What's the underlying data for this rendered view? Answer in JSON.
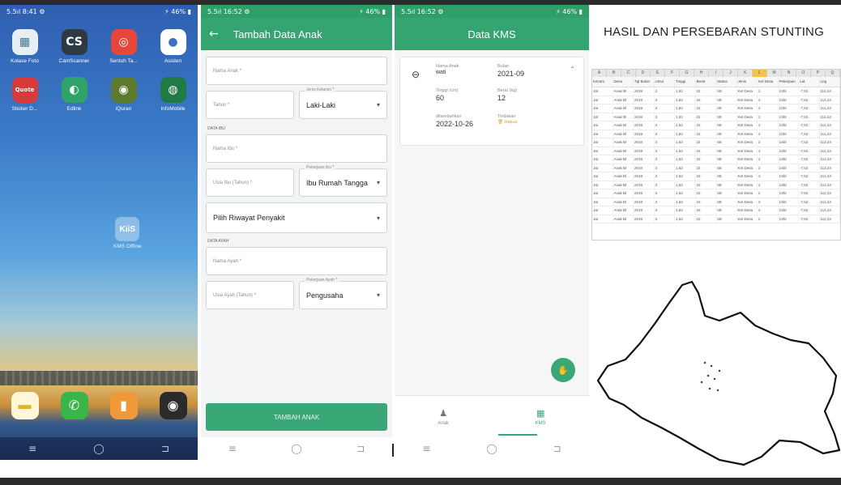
{
  "home": {
    "status_left": "5.5ıl 8:41 ⚙",
    "status_right": "⚡ 46% ▮",
    "apps": [
      {
        "label": "Kolase Foto",
        "icon": "grid-icon",
        "glyph": "▦",
        "color": "#e8eef6"
      },
      {
        "label": "CamScanner",
        "icon": "camscanner-icon",
        "glyph": "CS",
        "color": "#2d3a44"
      },
      {
        "label": "Sentuh Ta...",
        "icon": "swirl-icon",
        "glyph": "◎",
        "color": "#e6473a"
      },
      {
        "label": "Asisten",
        "icon": "assistant-icon",
        "glyph": "●",
        "color": "#ffffff"
      },
      {
        "label": "Sticker D...",
        "icon": "sticker-icon",
        "glyph": "Quote",
        "color": "#d83a3a"
      },
      {
        "label": "Edlink",
        "icon": "edlink-icon",
        "glyph": "◐",
        "color": "#2fa36a"
      },
      {
        "label": "iQuran",
        "icon": "quran-icon",
        "glyph": "◉",
        "color": "#5c7a2e"
      },
      {
        "label": "InfoMobile",
        "icon": "infomobile-icon",
        "glyph": "◍",
        "color": "#1f7a45"
      }
    ],
    "kids_label": "KMS Offline",
    "kids_icon_text": "KiiS",
    "dock": [
      {
        "icon": "notes-icon",
        "glyph": "▬",
        "color": "#fff7d8"
      },
      {
        "icon": "phone-icon",
        "glyph": "✆",
        "color": "#39b54a"
      },
      {
        "icon": "contacts-icon",
        "glyph": "▮",
        "color": "#f0993a"
      },
      {
        "icon": "camera-icon",
        "glyph": "◉",
        "color": "#2b2b2b"
      }
    ],
    "nav": [
      "≡",
      "◯",
      "⊐"
    ]
  },
  "form_screen": {
    "status_left": "5.5ıl 16:52 ⚙",
    "status_right": "⚡ 46% ▮",
    "back_icon": "←",
    "title": "Tambah Data Anak",
    "nama_anak": "Nama Anak *",
    "tahun": "Tahun *",
    "jenis_kelamin_label": "Jenis Kelamin *",
    "jenis_kelamin_value": "Laki-Laki",
    "section_ibu": "DATA IBU",
    "nama_ibu": "Nama Ibu *",
    "usia_ibu": "Usia Ibu (Tahun) *",
    "pekerjaan_ibu_label": "Pekerjaan Ibu *",
    "pekerjaan_ibu_value": "Ibu Rumah Tangga",
    "riwayat": "Pilih Riwayat Penyakit",
    "section_ayah": "DATA AYAH",
    "nama_ayah": "Nama Ayah *",
    "usia_ayah": "Usia Ayah (Tahun) *",
    "pekerjaan_ayah_label": "Pekerjaan Ayah *",
    "pekerjaan_ayah_value": "Pengusaha",
    "submit": "TAMBAH ANAK",
    "nav": [
      "≡",
      "◯",
      "⊐"
    ]
  },
  "kms_screen": {
    "status_left": "5.5ıl 16:52 ⚙",
    "status_right": "⚡ 46% ▮",
    "title": "Data KMS",
    "nama_anak_k": "Nama Anak",
    "nama_anak_v": "wati",
    "bulan_k": "Bulan",
    "bulan_v": "2021-09",
    "tinggi_k": "Tinggi (cm)",
    "tinggi_v": "60",
    "berat_k": "Berat (kg)",
    "berat_v": "12",
    "ditambahkan_k": "ditambahkan",
    "ditambahkan_v": "2022-10-26",
    "tindakan_k": "Tindakan",
    "tindakan_v": "🗑 Hapus",
    "fab_icon": "✋",
    "nav_anak": "Anak",
    "nav_kms": "KMS",
    "nav": [
      "≡",
      "◯",
      "⊐"
    ]
  },
  "right": {
    "title": "HASIL DAN PERSEBARAN STUNTING",
    "col_letters": [
      "A",
      "B",
      "C",
      "D",
      "E",
      "F",
      "G",
      "H",
      "I",
      "J",
      "K",
      "L",
      "M",
      "N",
      "O",
      "P",
      "Q"
    ],
    "headers": [
      "Kecam",
      "Desa",
      "Tgl Bulan",
      "Umur",
      "Tinggi",
      "Berat",
      "Status",
      "Jenis",
      "Kel Desa",
      "Pekerjaan",
      "Lat",
      "Lng"
    ],
    "rows": [
      [
        "Jat",
        "Anak Bl",
        "2019",
        "3",
        "1,52",
        "22",
        "SE",
        "Ket Desa",
        "2",
        "1Sbl",
        "-7,52",
        "112,24"
      ],
      [
        "Jat",
        "Anak Bl",
        "2019",
        "3",
        "1,52",
        "22",
        "SE",
        "Ket Desa",
        "2",
        "1Sbl",
        "-7,52",
        "112,24"
      ],
      [
        "Jat",
        "Anak Bl",
        "2019",
        "3",
        "1,52",
        "22",
        "SE",
        "Ket Desa",
        "2",
        "1Sbl",
        "-7,52",
        "112,24"
      ],
      [
        "Jat",
        "Anak Bl",
        "2019",
        "3",
        "1,52",
        "22",
        "SE",
        "Ket Desa",
        "2",
        "1Sbl",
        "-7,52",
        "112,24"
      ],
      [
        "Jat",
        "Anak Bl",
        "2019",
        "3",
        "1,52",
        "22",
        "SE",
        "Ket Desa",
        "2",
        "1Sbl",
        "-7,52",
        "112,24"
      ],
      [
        "Jat",
        "Anak Bl",
        "2019",
        "3",
        "1,52",
        "22",
        "SE",
        "Ket Desa",
        "2",
        "1Sbl",
        "-7,52",
        "112,24"
      ],
      [
        "Jat",
        "Anak Bl",
        "2019",
        "3",
        "1,52",
        "22",
        "SE",
        "Ket Desa",
        "2",
        "1Sbl",
        "-7,52",
        "112,24"
      ],
      [
        "Jat",
        "Anak Bl",
        "2019",
        "3",
        "1,52",
        "22",
        "SE",
        "Ket Desa",
        "2",
        "1Sbl",
        "-7,52",
        "112,24"
      ],
      [
        "Jat",
        "Anak Bl",
        "2019",
        "3",
        "1,52",
        "22",
        "SE",
        "Ket Desa",
        "2",
        "1Sbl",
        "-7,52",
        "112,24"
      ],
      [
        "Jat",
        "Anak Bl",
        "2019",
        "3",
        "1,52",
        "22",
        "SE",
        "Ket Desa",
        "2",
        "1Sbl",
        "-7,52",
        "112,24"
      ],
      [
        "Jat",
        "Anak Bl",
        "2019",
        "3",
        "1,52",
        "22",
        "SE",
        "Ket Desa",
        "2",
        "1Sbl",
        "-7,52",
        "112,24"
      ],
      [
        "Jat",
        "Anak Bl",
        "2019",
        "3",
        "1,52",
        "22",
        "SE",
        "Ket Desa",
        "2",
        "1Sbl",
        "-7,52",
        "112,24"
      ],
      [
        "Jat",
        "Anak Bl",
        "2019",
        "3",
        "1,52",
        "22",
        "SE",
        "Ket Desa",
        "2",
        "1Sbl",
        "-7,52",
        "112,24"
      ],
      [
        "Jat",
        "Anak Bl",
        "2019",
        "3",
        "1,52",
        "22",
        "SE",
        "Ket Desa",
        "2",
        "1Sbl",
        "-7,52",
        "112,24"
      ],
      [
        "Jat",
        "Anak Bl",
        "2019",
        "3",
        "1,52",
        "22",
        "SE",
        "Ket Desa",
        "2",
        "1Sbl",
        "-7,52",
        "112,24"
      ],
      [
        "Jat",
        "Anak Bl",
        "2019",
        "3",
        "1,52",
        "22",
        "SE",
        "Ket Desa",
        "2",
        "1Sbl",
        "-7,52",
        "112,24"
      ]
    ]
  }
}
